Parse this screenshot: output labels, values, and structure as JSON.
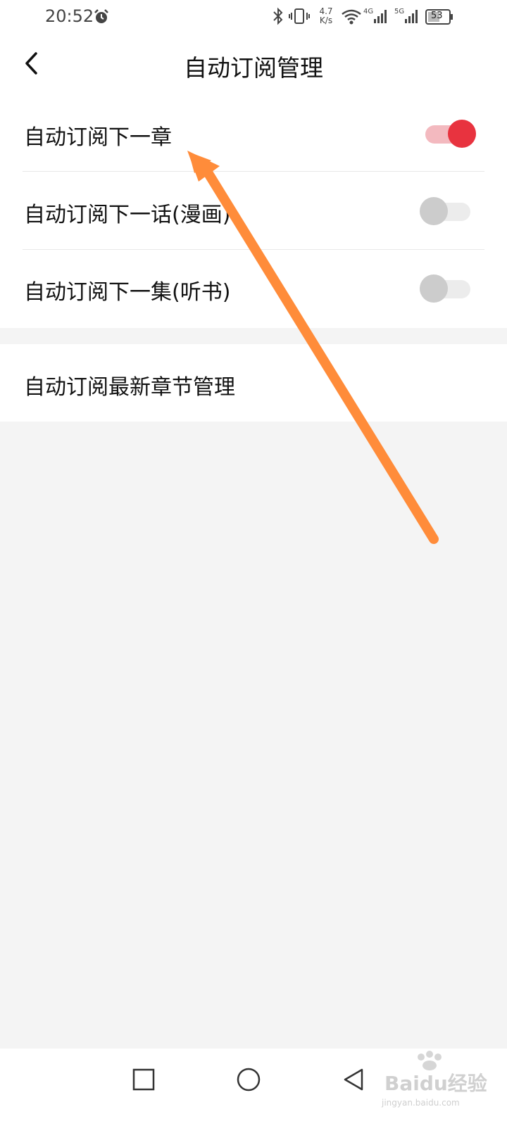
{
  "status_bar": {
    "time": "20:52",
    "network_speed_value": "4.7",
    "network_speed_unit": "K/s",
    "network_1": "4G",
    "network_2": "5G",
    "battery": "53",
    "icons": [
      "alarm-icon",
      "bluetooth-icon",
      "vibrate-icon",
      "wifi-icon",
      "signal-icon",
      "battery-icon"
    ]
  },
  "header": {
    "back_icon": "chevron-left-icon",
    "title": "自动订阅管理"
  },
  "settings": {
    "items": [
      {
        "label": "自动订阅下一章",
        "enabled": true
      },
      {
        "label": "自动订阅下一话(漫画)",
        "enabled": false
      },
      {
        "label": "自动订阅下一集(听书)",
        "enabled": false
      }
    ],
    "latest_management_label": "自动订阅最新章节管理"
  },
  "annotation": {
    "type": "arrow",
    "color": "#ff8c3a"
  },
  "nav_bar": {
    "buttons": [
      "recents-square-icon",
      "home-circle-icon",
      "back-triangle-icon"
    ]
  },
  "watermark": {
    "brand": "Baidu经验",
    "url": "jingyan.baidu.com"
  },
  "colors": {
    "accent_red": "#e8333f",
    "toggle_on_track": "#f3b9bf",
    "toggle_off_knob": "#cccccc",
    "toggle_off_track": "#ececec",
    "page_background": "#f4f4f4"
  }
}
